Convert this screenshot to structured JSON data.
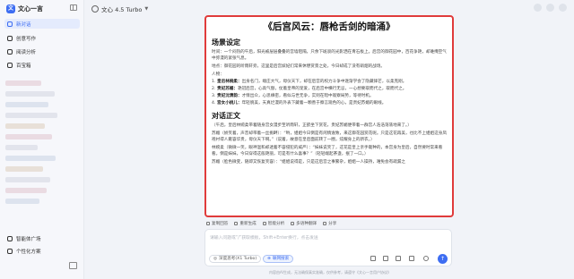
{
  "app": {
    "logo_text": "文心一言",
    "logo_mark": "文"
  },
  "sidebar": {
    "items": [
      {
        "label": "新对话",
        "active": true
      },
      {
        "label": "创意写作"
      },
      {
        "label": "阅读分析"
      },
      {
        "label": "百宝箱"
      }
    ],
    "footer": [
      {
        "label": "智能体广场"
      },
      {
        "label": "个性化方案"
      }
    ]
  },
  "topbar": {
    "model_label": "文心 4.5 Turbo"
  },
  "chat": {
    "title": "《后宫风云：唇枪舌剑的暗涌》",
    "scene_heading": "场景设定",
    "scene_time": "时间：一个闷热的午后，阳光被层层叠叠的宫墙阻隔，只余下斑驳的光影洒在青石板上。后宫的御花园中，百花争艳，却难掩空气中弥漫的紧张气息。",
    "scene_place": "地点：御花园的听雨轩旁，这里是后宫嫔妃们常来休憩赏景之处，今日却成了没有硝烟的战场。",
    "people_label": "人物：",
    "people": [
      {
        "num": "1.",
        "name": "皇后林婉柔：",
        "desc": "出身名门，端庄大气，母仪天下，却在后宫的权力斗争中逐渐学会了隐藏锋芒，以柔克刚。"
      },
      {
        "num": "2.",
        "name": "贵妃苏媚：",
        "desc": "艳冠后宫，心高气傲，仗着皇帝的宠爱，在后宫中横行无忌，一心想要取而代之，取而代之。"
      },
      {
        "num": "3.",
        "name": "贵妃沈清韵：",
        "desc": "才情出众，心思缜密，看似与世无争，实则在暗中观察局势，等待时机。"
      },
      {
        "num": "4.",
        "name": "宫女小桃儿：",
        "desc": "年轻貌美，天真烂漫的外表下藏着一颗善于察言观色的心，是贵妃苏媚的眼线。"
      }
    ],
    "dialog_heading": "对话正文",
    "dialog": [
      "（午后，皇后林婉柔带着随身宫女漫步至听雨轩，正欲坐下赏花，贵妃苏媚便带着一群宫人浩浩荡荡地来了。）",
      "苏媚（娇笑着，声音却带着一丝挑衅）：“哟，姐姐今日倒是有闲情逸致，来这御花园赏花呢。只是这花再美，也比不上姐姐这身凤袍衬得人雍容华贵，母仪天下啊。”（说着，故意在皇后面前转了一圈，炫耀身上的新衣。）",
      "林婉柔（微微一笑，眼神温和却透着不容侵犯的威严）：“妹妹说笑了，这花是皇上亲手栽种的，本宫身为皇后，自然要时常来看看。倒是妹妹，今日穿得这般艳丽，可是有什么喜事？”（轻轻端起茶盏，抿了一口。）",
      "苏媚（脸色微变，随即又恢复笑容）：“姐姐说得是，只是这后宫之事繁杂，姐姐一人操持，难免会有疏漏之"
    ]
  },
  "actions": [
    "复制回答",
    "重新生成",
    "智能分析",
    "多语种翻译",
    "分享"
  ],
  "input": {
    "placeholder": "请输入问题或“/”获取模板，Shift+Enter换行，点击发送",
    "chip_model": "深度思考(X1 Turbo)",
    "chip_search": "联网搜索",
    "send_icon": "↑"
  },
  "footer": "内容由AI生成，无法确保真实准确，仅供参考，请遵守《文心一言用户协议》"
}
